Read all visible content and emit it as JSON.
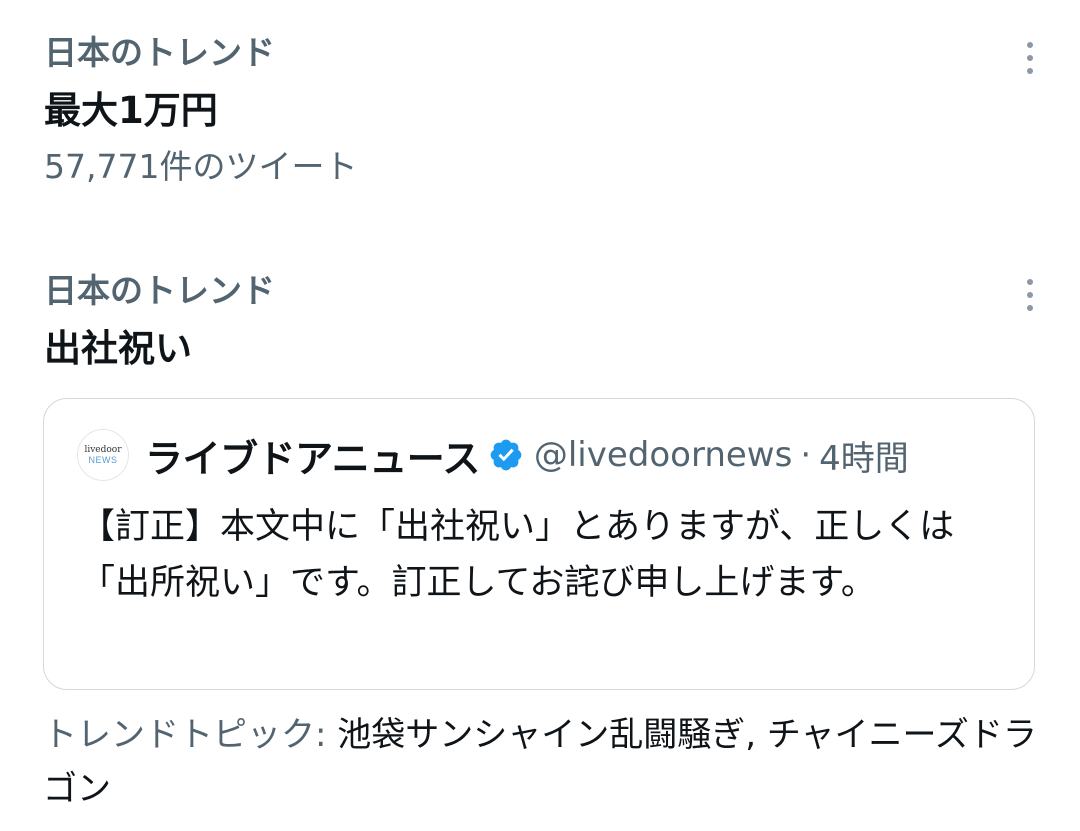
{
  "trends": [
    {
      "context": "日本のトレンド",
      "name": "最大1万円",
      "tweet_count": "57,771件のツイート"
    },
    {
      "context": "日本のトレンド",
      "name": "出社祝い"
    }
  ],
  "quote": {
    "avatar_text_top": "livedoor",
    "avatar_text_bottom": "NEWS",
    "author_name": "ライブドアニュース",
    "handle": "@livedoornews",
    "separator": "·",
    "time": "4時間",
    "body": "【訂正】本文中に「出社祝い」とありますが、正しくは「出所祝い」です。訂正してお詫び申し上げます。"
  },
  "topics": {
    "label": "トレンドトピック:",
    "value": "池袋サンシャイン乱闘騒ぎ, チャイニーズドラゴン"
  },
  "icons": {
    "more": "more-vertical-icon",
    "verified": "verified-badge-icon"
  },
  "colors": {
    "secondary_text": "#536471",
    "primary_text": "#0f1419",
    "verified_blue": "#1d9bf0",
    "border": "#cfd9de"
  }
}
